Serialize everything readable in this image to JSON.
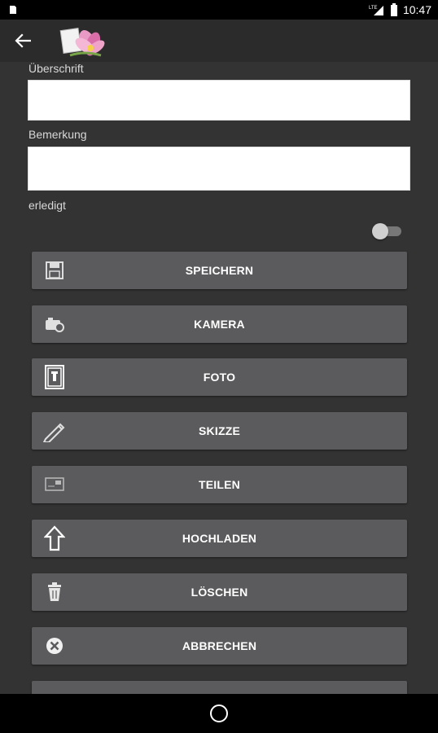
{
  "status_bar": {
    "time": "10:47",
    "network_label": "LTE",
    "icons": [
      "notification-icon",
      "signal-icon",
      "battery-icon"
    ]
  },
  "app_bar": {
    "icons": [
      "back-arrow-icon",
      "lotus-logo-icon"
    ]
  },
  "form": {
    "heading_label": "Überschrift",
    "heading_value": "",
    "remark_label": "Bemerkung",
    "remark_value": "",
    "done_label": "erledigt",
    "done_checked": false
  },
  "buttons": [
    {
      "label": "SPEICHERN",
      "icon": "floppy-disk-icon"
    },
    {
      "label": "KAMERA",
      "icon": "camera-icon"
    },
    {
      "label": "FOTO",
      "icon": "photo-frame-icon"
    },
    {
      "label": "SKIZZE",
      "icon": "pencil-icon"
    },
    {
      "label": "TEILEN",
      "icon": "share-card-icon"
    },
    {
      "label": "HOCHLADEN",
      "icon": "upload-arrow-icon"
    },
    {
      "label": "LÖSCHEN",
      "icon": "trash-icon"
    },
    {
      "label": "ABBRECHEN",
      "icon": "cancel-circle-icon"
    },
    {
      "label": "",
      "icon": "more-icon"
    }
  ],
  "colors": {
    "background": "#333333",
    "app_bar": "#2b2b2b",
    "button": "#5b5b5d",
    "status_bar": "#000000"
  }
}
